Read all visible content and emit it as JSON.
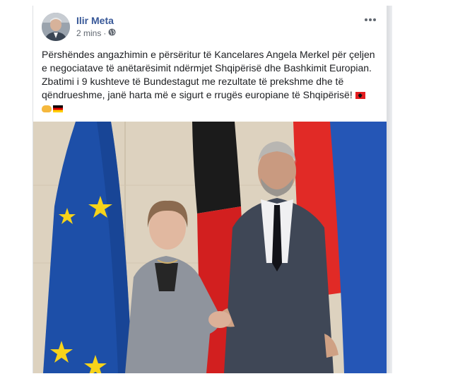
{
  "post": {
    "author": "Ilir Meta",
    "time": "2 mins",
    "separator": "·",
    "privacy_icon": "globe-icon",
    "more_icon": "more-options-icon",
    "text_line1": "Përshëndes angazhimin e përsëritur të Kancelares Angela Merkel për çeljen e negociatave të anëtarësimit ndërmjet Shqipërisë dhe Bashkimit Europian.",
    "text_line2": "Zbatimi i 9 kushteve të Bundestagut me rezultate të prekshme dhe të qëndrueshme, janë harta më e sigurt e rrugës europiane të Shqipërisë!",
    "emojis": [
      "albania-flag-icon",
      "handshake-icon",
      "germany-flag-icon"
    ]
  },
  "colors": {
    "author_link": "#385898",
    "meta_text": "#606770",
    "body_text": "#1c1e21"
  }
}
